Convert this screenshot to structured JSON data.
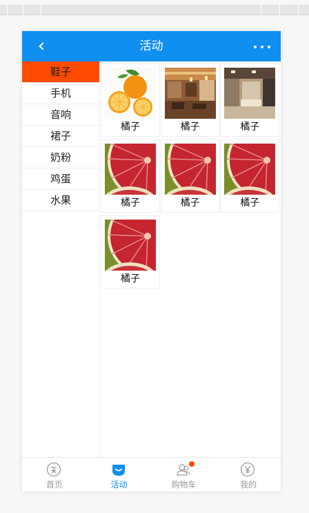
{
  "header": {
    "title": "活动"
  },
  "sidebar": {
    "items": [
      "鞋子",
      "手机",
      "音响",
      "裙子",
      "奶粉",
      "鸡蛋",
      "水果"
    ],
    "active_index": 0
  },
  "products": [
    {
      "name": "橘子",
      "image": "orange-fruit"
    },
    {
      "name": "橘子",
      "image": "restaurant-interior"
    },
    {
      "name": "橘子",
      "image": "shop-interior"
    },
    {
      "name": "橘子",
      "image": "grapefruit-slice"
    },
    {
      "name": "橘子",
      "image": "grapefruit-slice"
    },
    {
      "name": "橘子",
      "image": "grapefruit-slice"
    },
    {
      "name": "橘子",
      "image": "grapefruit-slice"
    }
  ],
  "tabbar": {
    "items": [
      {
        "label": "首页",
        "icon": "home-coin-icon"
      },
      {
        "label": "活动",
        "icon": "activity-smile-icon"
      },
      {
        "label": "购物车",
        "icon": "cart-people-icon"
      },
      {
        "label": "我的",
        "icon": "yen-icon"
      }
    ],
    "active_index": 1
  },
  "colors": {
    "header": "#0f8ff0",
    "active_sidebar": "#ff4a00",
    "badge": "#ff4a00",
    "tab_active": "#0f8ff0",
    "tab_inactive": "#999999"
  }
}
